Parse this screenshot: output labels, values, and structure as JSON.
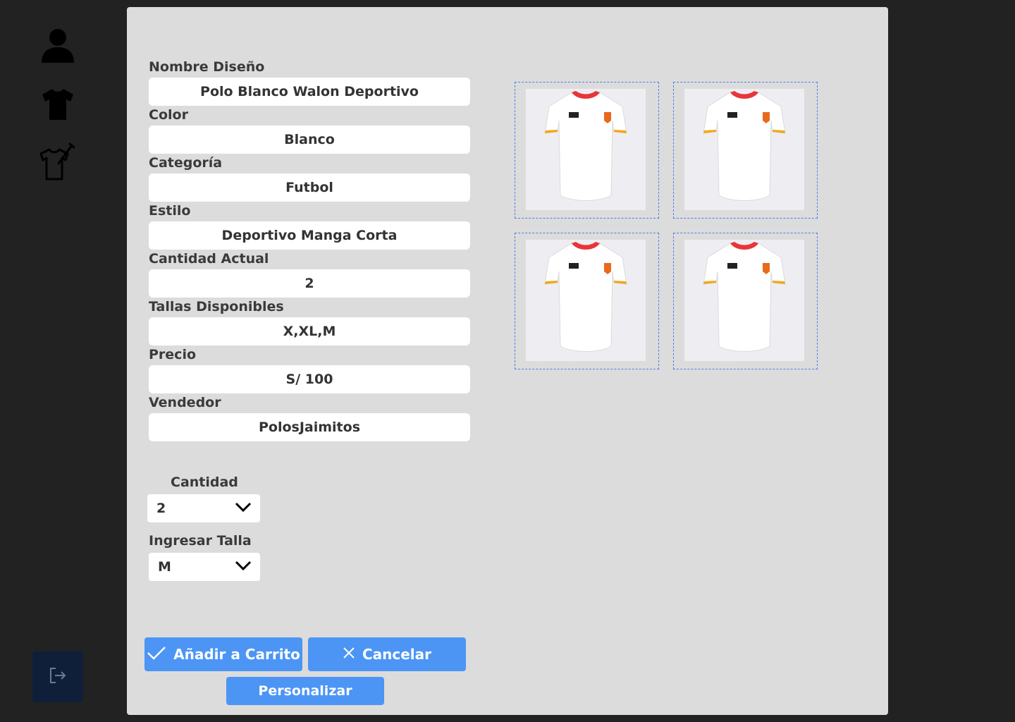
{
  "sidebar": {
    "icons": [
      "user-icon",
      "shirt-icon",
      "design-shirt-icon"
    ],
    "logout_icon": "logout-icon"
  },
  "form": {
    "fields": [
      {
        "label": "Nombre Diseño",
        "value": "Polo Blanco Walon Deportivo"
      },
      {
        "label": "Color",
        "value": "Blanco"
      },
      {
        "label": "Categoría",
        "value": "Futbol"
      },
      {
        "label": "Estilo",
        "value": "Deportivo Manga Corta"
      },
      {
        "label": "Cantidad Actual",
        "value": "2"
      },
      {
        "label": "Tallas Disponibles",
        "value": "X,XL,M"
      },
      {
        "label": "Precio",
        "value": "S/ 100"
      },
      {
        "label": "Vendedor",
        "value": "PolosJaimitos"
      }
    ]
  },
  "quantity": {
    "label": "Cantidad",
    "selected": "2"
  },
  "size": {
    "label": "Ingresar Talla",
    "selected": "M"
  },
  "buttons": {
    "add_to_cart": "Añadir a Carrito",
    "cancel": "Cancelar",
    "customize": "Personalizar"
  },
  "gallery": {
    "images": [
      "shirt-preview-1",
      "shirt-preview-2",
      "shirt-preview-3",
      "shirt-preview-4"
    ]
  },
  "colors": {
    "background": "#222222",
    "modal": "#dcdcdc",
    "accent": "#4c95f5",
    "logout": "#0f1f3a"
  }
}
